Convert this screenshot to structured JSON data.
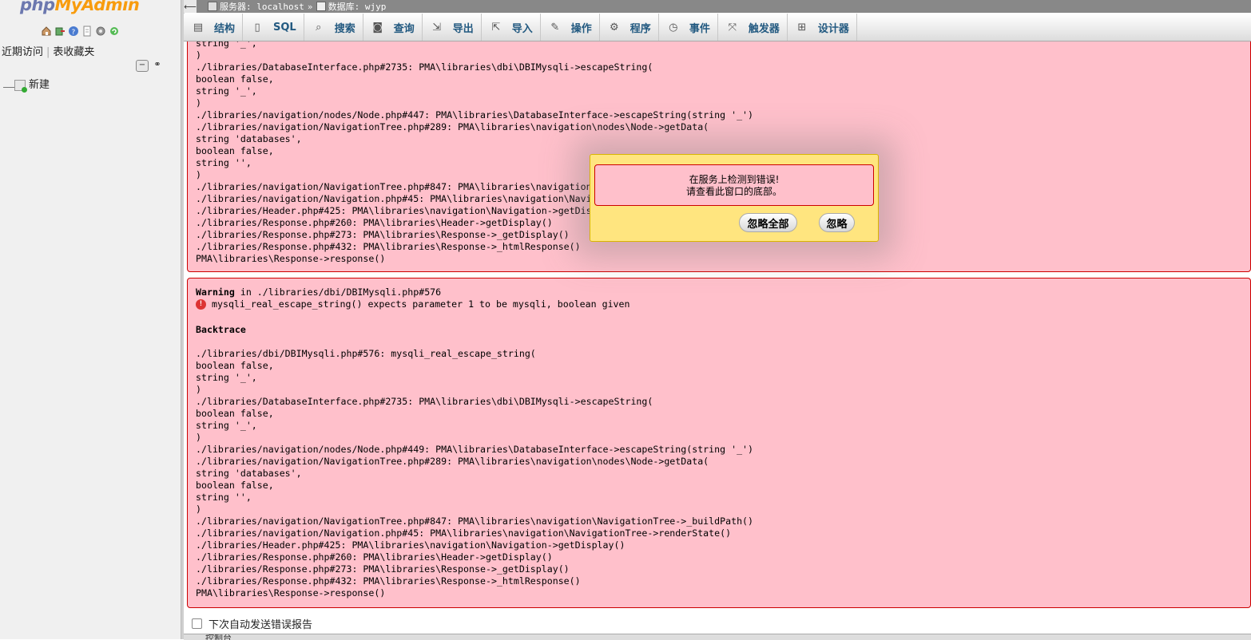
{
  "sidebar": {
    "logo_part1": "php",
    "logo_part2": "MyAdmin",
    "quick_icons": [
      "home-icon",
      "logout-icon",
      "help-icon",
      "docs-icon",
      "settings-icon",
      "reload-icon"
    ],
    "tabs": [
      "近期访问",
      "表收藏夹"
    ],
    "tree_new": "新建"
  },
  "breadcrumb": {
    "server": "服务器: localhost",
    "database": "数据库: wjyp"
  },
  "menu": [
    {
      "label": "结构",
      "icon": "structure-icon"
    },
    {
      "label": "SQL",
      "icon": "sql-icon"
    },
    {
      "label": "搜索",
      "icon": "search-icon"
    },
    {
      "label": "查询",
      "icon": "query-icon"
    },
    {
      "label": "导出",
      "icon": "export-icon"
    },
    {
      "label": "导入",
      "icon": "import-icon"
    },
    {
      "label": "操作",
      "icon": "operations-icon"
    },
    {
      "label": "程序",
      "icon": "routines-icon"
    },
    {
      "label": "事件",
      "icon": "events-icon"
    },
    {
      "label": "触发器",
      "icon": "triggers-icon"
    },
    {
      "label": "设计器",
      "icon": "designer-icon"
    }
  ],
  "error1_lines": [
    "string '_',",
    ")",
    "./libraries/DatabaseInterface.php#2735: PMA\\libraries\\dbi\\DBIMysqli->escapeString(",
    "boolean false,",
    "string '_',",
    ")",
    "./libraries/navigation/nodes/Node.php#447: PMA\\libraries\\DatabaseInterface->escapeString(string '_')",
    "./libraries/navigation/NavigationTree.php#289: PMA\\libraries\\navigation\\nodes\\Node->getData(",
    "string 'databases',",
    "boolean false,",
    "string '',",
    ")",
    "./libraries/navigation/NavigationTree.php#847: PMA\\libraries\\navigation",
    "./libraries/navigation/Navigation.php#45: PMA\\libraries\\navigation\\Navi",
    "./libraries/Header.php#425: PMA\\libraries\\navigation\\Navigation->getDis",
    "./libraries/Response.php#260: PMA\\libraries\\Header->getDisplay()",
    "./libraries/Response.php#273: PMA\\libraries\\Response->_getDisplay()",
    "./libraries/Response.php#432: PMA\\libraries\\Response->_htmlResponse()",
    "PMA\\libraries\\Response->response()"
  ],
  "error2": {
    "warning_label": "Warning",
    "warning_location": " in ./libraries/dbi/DBIMysqli.php#576",
    "message": "mysqli_real_escape_string() expects parameter 1 to be mysqli, boolean given",
    "backtrace_title": "Backtrace",
    "lines": [
      "./libraries/dbi/DBIMysqli.php#576: mysqli_real_escape_string(",
      "boolean false,",
      "string '_',",
      ")",
      "./libraries/DatabaseInterface.php#2735: PMA\\libraries\\dbi\\DBIMysqli->escapeString(",
      "boolean false,",
      "string '_',",
      ")",
      "./libraries/navigation/nodes/Node.php#449: PMA\\libraries\\DatabaseInterface->escapeString(string '_')",
      "./libraries/navigation/NavigationTree.php#289: PMA\\libraries\\navigation\\nodes\\Node->getData(",
      "string 'databases',",
      "boolean false,",
      "string '',",
      ")",
      "./libraries/navigation/NavigationTree.php#847: PMA\\libraries\\navigation\\NavigationTree->_buildPath()",
      "./libraries/navigation/Navigation.php#45: PMA\\libraries\\navigation\\NavigationTree->renderState()",
      "./libraries/Header.php#425: PMA\\libraries\\navigation\\Navigation->getDisplay()",
      "./libraries/Response.php#260: PMA\\libraries\\Header->getDisplay()",
      "./libraries/Response.php#273: PMA\\libraries\\Response->_getDisplay()",
      "./libraries/Response.php#432: PMA\\libraries\\Response->_htmlResponse()",
      "PMA\\libraries\\Response->response()"
    ]
  },
  "dialog": {
    "line1": "在服务上检测到错误!",
    "line2": "请查看此窗口的底部。",
    "ignore_all": "忽略全部",
    "ignore": "忽略"
  },
  "footer": {
    "auto_report_label": "下次自动发送错误报告",
    "console_label": "控制台"
  }
}
